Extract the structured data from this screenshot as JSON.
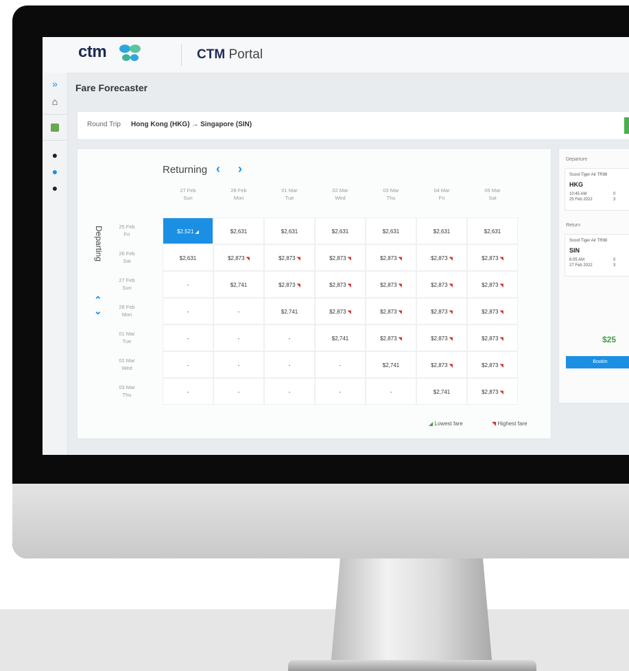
{
  "app": {
    "logo_text": "ctm",
    "portal_prefix": "CTM",
    "portal_suffix": "Portal"
  },
  "page_title": "Fare Forecaster",
  "trip": {
    "type": "Round Trip",
    "route": "Hong Kong (HKG) → Singapore (SIN)"
  },
  "rail_icons": [
    "expand-icon",
    "home-icon",
    "document-icon",
    "navigate-icon",
    "dollar-icon",
    "info-icon"
  ],
  "grid": {
    "returning_label": "Returning",
    "departing_label": "Departing",
    "prev_symbol": "‹",
    "next_symbol": "›",
    "up_symbol": "⌃",
    "down_symbol": "⌄",
    "columns": [
      {
        "date": "27 Feb",
        "day": "Sun"
      },
      {
        "date": "28 Feb",
        "day": "Mon"
      },
      {
        "date": "01 Mar",
        "day": "Tue"
      },
      {
        "date": "02 Mar",
        "day": "Wed"
      },
      {
        "date": "03 Mar",
        "day": "Thu"
      },
      {
        "date": "04 Mar",
        "day": "Fri"
      },
      {
        "date": "05 Mar",
        "day": "Sat"
      }
    ],
    "rows": [
      {
        "date": "25 Feb",
        "day": "Fri",
        "cells": [
          "$2,521",
          "$2,631",
          "$2,631",
          "$2,631",
          "$2,631",
          "$2,631",
          "$2,631"
        ],
        "marks": [
          "low",
          "",
          "",
          "",
          "",
          "",
          ""
        ]
      },
      {
        "date": "26 Feb",
        "day": "Sat",
        "cells": [
          "$2,631",
          "$2,873",
          "$2,873",
          "$2,873",
          "$2,873",
          "$2,873",
          "$2,873"
        ],
        "marks": [
          "",
          "high",
          "high",
          "high",
          "high",
          "high",
          "high"
        ]
      },
      {
        "date": "27 Feb",
        "day": "Sun",
        "cells": [
          "-",
          "$2,741",
          "$2,873",
          "$2,873",
          "$2,873",
          "$2,873",
          "$2,873"
        ],
        "marks": [
          "",
          "",
          "high",
          "high",
          "high",
          "high",
          "high"
        ]
      },
      {
        "date": "28 Feb",
        "day": "Mon",
        "cells": [
          "-",
          "-",
          "$2,741",
          "$2,873",
          "$2,873",
          "$2,873",
          "$2,873"
        ],
        "marks": [
          "",
          "",
          "",
          "high",
          "high",
          "high",
          "high"
        ]
      },
      {
        "date": "01 Mar",
        "day": "Tue",
        "cells": [
          "-",
          "-",
          "-",
          "$2,741",
          "$2,873",
          "$2,873",
          "$2,873"
        ],
        "marks": [
          "",
          "",
          "",
          "",
          "high",
          "high",
          "high"
        ]
      },
      {
        "date": "02 Mar",
        "day": "Wed",
        "cells": [
          "-",
          "-",
          "-",
          "-",
          "$2,741",
          "$2,873",
          "$2,873"
        ],
        "marks": [
          "",
          "",
          "",
          "",
          "",
          "high",
          "high"
        ]
      },
      {
        "date": "03 Mar",
        "day": "Thu",
        "cells": [
          "-",
          "-",
          "-",
          "-",
          "-",
          "$2,741",
          "$2,873"
        ],
        "marks": [
          "",
          "",
          "",
          "",
          "",
          "",
          "high"
        ]
      }
    ],
    "selected": {
      "row": 0,
      "col": 0
    },
    "legend": {
      "lowest": "Lowest fare",
      "highest": "Highest fare"
    }
  },
  "side": {
    "departure_label": "Departure",
    "return_label": "Return",
    "departure": {
      "airline": "Scoot Tiger Air TR98",
      "airport": "HKG",
      "time": "10:45 AM",
      "date": "25 Feb 2022",
      "col2_a": "0",
      "col2_b": "3"
    },
    "return": {
      "airline": "Scoot Tiger Air TR98",
      "airport": "SIN",
      "time": "6:05 AM",
      "date": "27 Feb 2022",
      "col2_a": "0",
      "col2_b": "3"
    },
    "price": "$25",
    "book_label": "Bookin"
  },
  "colors": {
    "accent": "#1a8fe3",
    "low": "#43a047",
    "high": "#d32f2f",
    "brand": "#1d2a55"
  }
}
